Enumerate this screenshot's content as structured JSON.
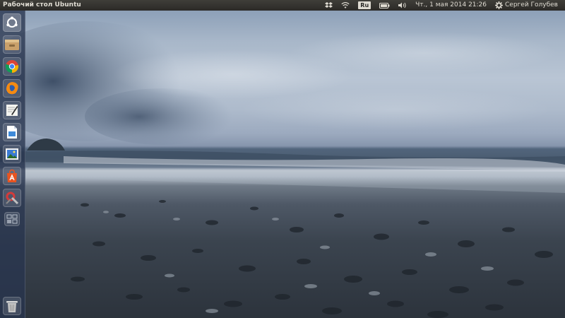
{
  "top_panel": {
    "title": "Рабочий стол Ubuntu",
    "language": "Ru",
    "datetime": "Чт., 1 мая 2014 21:26",
    "user": "Сергей Голубев",
    "icons": [
      "dropbox-icon",
      "wifi-icon",
      "keyboard-layout-indicator",
      "battery-icon",
      "volume-icon",
      "session-gear-icon"
    ]
  },
  "launcher": {
    "items": [
      {
        "name": "dash-home",
        "icon": "ubuntu-logo-icon"
      },
      {
        "name": "files",
        "icon": "file-manager-icon"
      },
      {
        "name": "chrome",
        "icon": "chrome-icon"
      },
      {
        "name": "firefox",
        "icon": "firefox-icon"
      },
      {
        "name": "text-editor",
        "icon": "text-editor-icon"
      },
      {
        "name": "libreoffice-writer",
        "icon": "document-icon"
      },
      {
        "name": "image-viewer",
        "icon": "image-viewer-icon"
      },
      {
        "name": "software-center",
        "icon": "software-center-icon"
      },
      {
        "name": "system-settings",
        "icon": "system-settings-icon"
      },
      {
        "name": "workspace-switcher",
        "icon": "workspace-switcher-icon"
      },
      {
        "name": "trash",
        "icon": "trash-icon"
      }
    ]
  },
  "colors": {
    "panel_bg": "#2b2a27",
    "panel_text": "#dfdbd2",
    "launcher_bg": "#28344e",
    "ubuntu_orange": "#e95420"
  }
}
